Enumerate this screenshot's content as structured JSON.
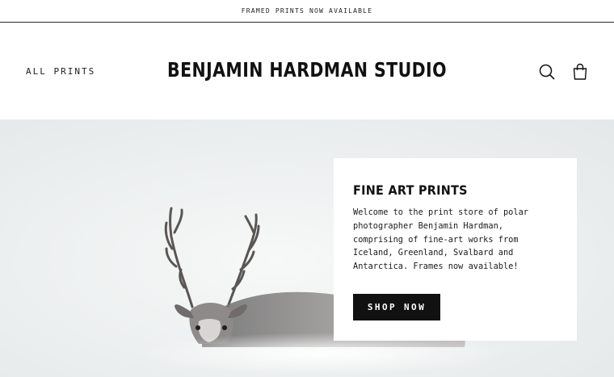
{
  "announcement": {
    "text": "FRAMED PRINTS NOW AVAILABLE"
  },
  "header": {
    "nav_all_prints": "ALL PRINTS",
    "brand": "BENJAMIN HARDMAN STUDIO",
    "icons": [
      "search-icon",
      "cart-icon"
    ]
  },
  "hero": {
    "card": {
      "title": "FINE ART PRINTS",
      "body": "Welcome to the print store of polar photographer Benjamin Hardman, comprising of fine-art works from Iceland, Greenland, Svalbard and Antarctica. Frames now available!",
      "cta": "SHOP NOW"
    }
  },
  "colors": {
    "text": "#111111",
    "button_bg": "#111111",
    "button_text": "#ffffff",
    "hero_bg": "#eef1f1"
  }
}
